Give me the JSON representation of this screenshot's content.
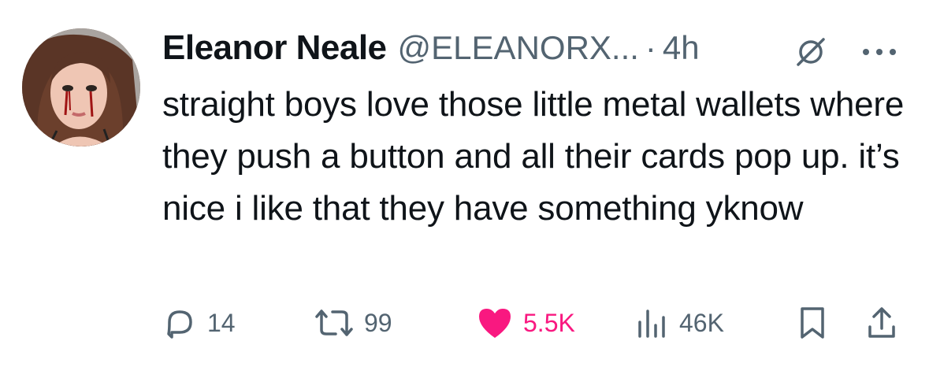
{
  "author": {
    "name": "Eleanor Neale",
    "handle": "@ELEANORX...",
    "separator": "·",
    "time": "4h"
  },
  "tweet": {
    "text": "straight boys love those little metal wallets where they push a button and all their cards pop up. it’s nice i like that they have something yknow"
  },
  "actions": {
    "replies": "14",
    "reposts": "99",
    "likes": "5.5K",
    "views": "46K"
  },
  "colors": {
    "text": "#0f1419",
    "secondary": "#536471",
    "like": "#f91880"
  },
  "icons": [
    "grok-icon",
    "more-icon",
    "reply-icon",
    "repost-icon",
    "heart-icon",
    "views-icon",
    "bookmark-icon",
    "share-icon"
  ]
}
